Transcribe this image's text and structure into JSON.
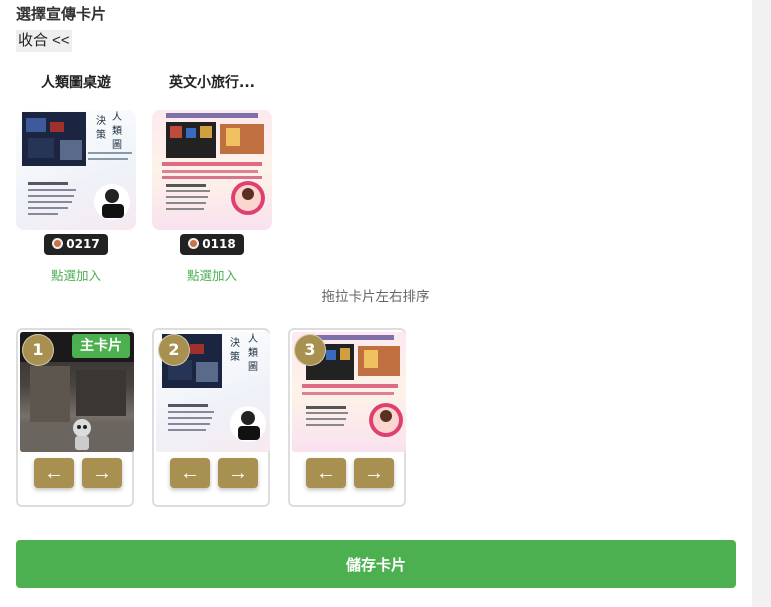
{
  "section_title": "選擇宣傳卡片",
  "collapse_label": "收合 <<",
  "source_cards": [
    {
      "title": "人類圖桌遊",
      "views": "0217",
      "add_label": "點選加入",
      "poster_text": "決策的工具"
    },
    {
      "title": "英文小旅行...",
      "views": "0118",
      "add_label": "點選加入",
      "poster_text": "5/13 10:00"
    }
  ],
  "sort_hint": "拖拉卡片左右排序",
  "slots": [
    {
      "number": "1",
      "badge": "主卡片"
    },
    {
      "number": "2"
    },
    {
      "number": "3"
    }
  ],
  "arrows": {
    "left": "←",
    "right": "→"
  },
  "save_label": "儲存卡片",
  "colors": {
    "accent_gold": "#a89050",
    "green": "#4caf50",
    "dark": "#222222"
  }
}
